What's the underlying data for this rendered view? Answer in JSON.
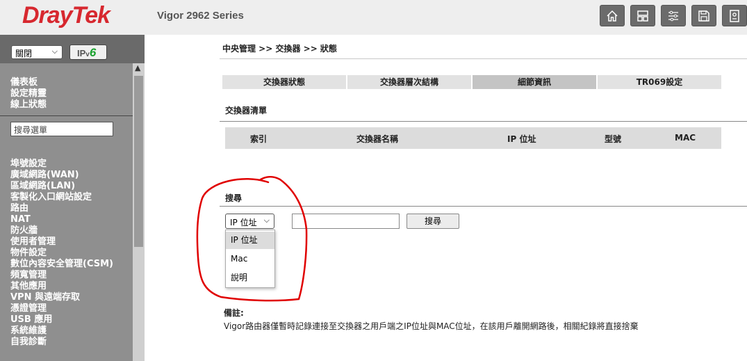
{
  "header": {
    "logo": "DrayTek",
    "model": "Vigor 2962 Series",
    "buttons": [
      "home-icon",
      "layout-icon",
      "sliders-icon",
      "save-icon",
      "logout-icon"
    ]
  },
  "sidebar": {
    "language": "關閉",
    "ipv6_badge": {
      "prefix": "IP",
      "v": "v",
      "six": "6"
    },
    "top_items": [
      "儀表板",
      "設定精靈",
      "線上狀態"
    ],
    "search_value": "搜尋選單",
    "items": [
      "埠號設定",
      "廣域網路(WAN)",
      "區域網路(LAN)",
      "客製化入口網站設定",
      "路由",
      "NAT",
      "防火牆",
      "使用者管理",
      "物件設定",
      "數位內容安全管理(CSM)",
      "頻寬管理",
      "其他應用",
      "VPN 與遠端存取",
      "憑證管理",
      "USB 應用",
      "系統維護",
      "自我診斷"
    ]
  },
  "main": {
    "breadcrumb": "中央管理 >> 交換器 >> 狀態",
    "tabs": [
      {
        "label": "交換器狀態",
        "active": false
      },
      {
        "label": "交換器層次結構",
        "active": false
      },
      {
        "label": "細節資訊",
        "active": true
      },
      {
        "label": "TR069設定",
        "active": false
      }
    ],
    "switch_list_title": "交換器清單",
    "table_columns": [
      "索引",
      "交換器名稱",
      "IP 位址",
      "型號",
      "MAC"
    ],
    "search_title": "搜尋",
    "search_select": "IP 位址",
    "search_options": [
      "IP 位址",
      "Mac",
      "說明"
    ],
    "search_input_value": "",
    "search_button": "搜尋",
    "note_title": "備註:",
    "note_text": "Vigor路由器僅暫時記錄連接至交換器之用戶端之IP位址與MAC位址，在該用戶離開網路後，相關紀錄將直接捨棄"
  },
  "colors": {
    "brand_red": "#d7282f",
    "sidebar_bg": "#8f8f8f",
    "annotation_red": "#e00000"
  }
}
